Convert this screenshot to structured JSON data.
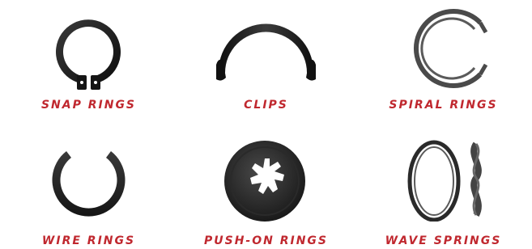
{
  "accent_color": "#c0282f",
  "ring_color": "#1e1e1e",
  "products": [
    {
      "label": "Snap Rings",
      "icon": "snap-ring-icon"
    },
    {
      "label": "Clips",
      "icon": "clip-icon"
    },
    {
      "label": "Spiral Rings",
      "icon": "spiral-ring-icon"
    },
    {
      "label": "Wire Rings",
      "icon": "wire-ring-icon"
    },
    {
      "label": "Push-On Rings",
      "icon": "push-on-ring-icon"
    },
    {
      "label": "Wave Springs",
      "icon": "wave-spring-icon"
    }
  ]
}
